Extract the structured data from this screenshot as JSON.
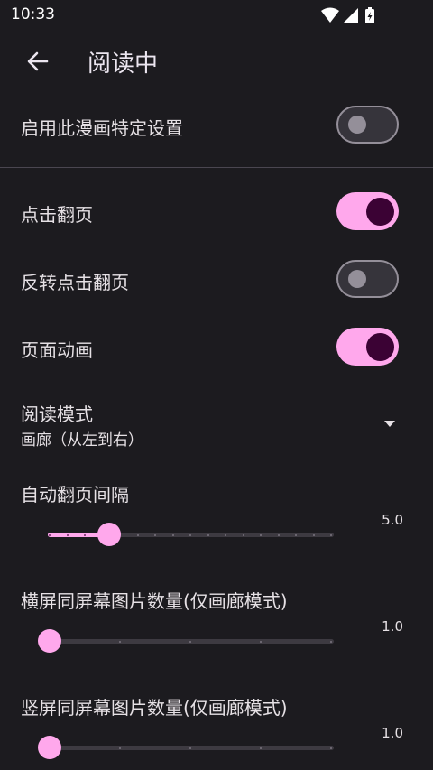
{
  "status_bar": {
    "time": "10:33",
    "icons": [
      "wifi-icon",
      "signal-icon",
      "battery-charging-icon"
    ]
  },
  "app_bar": {
    "title": "阅读中",
    "back_icon": "arrow-back-icon"
  },
  "settings": {
    "manga_specific": {
      "label": "启用此漫画特定设置",
      "enabled": false
    },
    "tap_to_turn": {
      "label": "点击翻页",
      "enabled": true
    },
    "invert_tap": {
      "label": "反转点击翻页",
      "enabled": false
    },
    "page_animation": {
      "label": "页面动画",
      "enabled": true
    },
    "reading_mode": {
      "label": "阅读模式",
      "value": "画廊（从左到右）",
      "icon": "dropdown-arrow-icon"
    },
    "auto_turn_interval": {
      "label": "自动翻页间隔",
      "value": "5.0",
      "fraction": 0.2
    },
    "landscape_images": {
      "label": "横屏同屏幕图片数量(仅画廊模式)",
      "value": "1.0",
      "fraction": 0.0
    },
    "portrait_images": {
      "label": "竖屏同屏幕图片数量(仅画廊模式)",
      "value": "1.0",
      "fraction": 0.0
    }
  },
  "colors": {
    "background": "#1c1b1f",
    "accent": "#ffa8ec",
    "thumb_on": "#3b0234",
    "off": "#948f99"
  }
}
